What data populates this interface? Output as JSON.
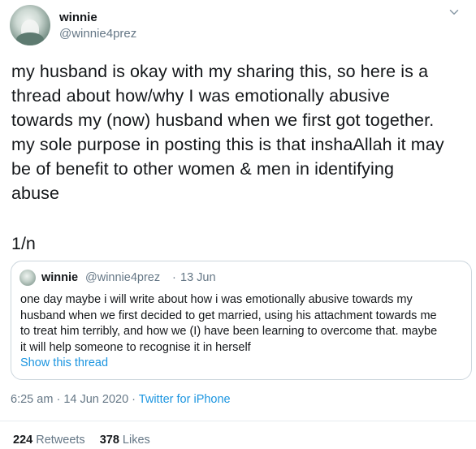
{
  "author": {
    "display_name": "winnie",
    "handle": "@winnie4prez"
  },
  "tweet": {
    "lines": [
      "my husband is okay with my sharing this, so here is a",
      "thread about how/why I was emotionally abusive",
      "towards my (now) husband when we first got together.",
      "my sole purpose in posting this is that inshaAllah it may",
      "be of benefit to other women & men in identifying",
      "abuse"
    ],
    "thread_marker": "1/n"
  },
  "quoted_tweet": {
    "display_name": "winnie",
    "handle": "@winnie4prez",
    "separator": "·",
    "date": "13 Jun",
    "lines": [
      "one day maybe i will write about how i was emotionally abusive towards my",
      "husband when we first decided to get married, using his attachment towards me",
      "to treat him terribly, and how we (I) have been learning to overcome that. maybe",
      "it will help someone to recognise it in herself"
    ],
    "show_thread_label": "Show this thread"
  },
  "meta": {
    "time": "6:25 am",
    "date": "14 Jun 2020",
    "separator": "·",
    "source": "Twitter for iPhone"
  },
  "stats": {
    "retweets_count": "224",
    "retweets_label": "Retweets",
    "likes_count": "378",
    "likes_label": "Likes"
  },
  "colors": {
    "link": "#1b95e0",
    "secondary_text": "#657786",
    "border": "#ccd6dd"
  },
  "icons": {
    "avatar": "profile-photo",
    "caret": "chevron-down-icon"
  }
}
